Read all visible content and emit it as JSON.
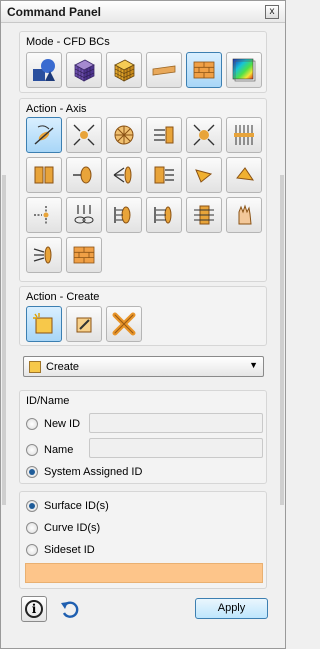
{
  "window": {
    "title": "Command Panel",
    "close_label": "x"
  },
  "mode": {
    "title": "Mode - CFD BCs",
    "buttons": [
      {
        "icon": "solid-shapes-icon",
        "active": false
      },
      {
        "icon": "purple-mesh-cube-icon",
        "active": false
      },
      {
        "icon": "yellow-mesh-cube-icon",
        "active": false
      },
      {
        "icon": "surface-plank-icon",
        "active": false
      },
      {
        "icon": "brick-wall-icon",
        "active": true
      },
      {
        "icon": "contour-plot-icon",
        "active": false
      }
    ]
  },
  "action_axis": {
    "title": "Action - Axis",
    "buttons": [
      {
        "icon": "axis-rotate-icon",
        "active": true
      },
      {
        "icon": "fan-icon"
      },
      {
        "icon": "propeller-icon"
      },
      {
        "icon": "inlet-arrows-icon"
      },
      {
        "icon": "fan-sink-icon"
      },
      {
        "icon": "vent-lines-icon"
      },
      {
        "icon": "split-block-icon"
      },
      {
        "icon": "orifice-icon"
      },
      {
        "icon": "flow-spread-icon"
      },
      {
        "icon": "grille-arrows-icon"
      },
      {
        "icon": "triangle-flap-icon"
      },
      {
        "icon": "triangle-flap-alt-icon"
      },
      {
        "icon": "point-flow-icon"
      },
      {
        "icon": "multi-flow-icon"
      },
      {
        "icon": "bracket-flow-icon"
      },
      {
        "icon": "ellipse-flow-icon"
      },
      {
        "icon": "stack-flow-icon"
      },
      {
        "icon": "hand-icon"
      },
      {
        "icon": "disk-arrows-icon"
      },
      {
        "icon": "brick-icon"
      }
    ]
  },
  "action_create": {
    "title": "Action - Create",
    "buttons": [
      {
        "icon": "new-block-icon",
        "active": true
      },
      {
        "icon": "edit-pencil-icon"
      },
      {
        "icon": "delete-x-icon"
      }
    ]
  },
  "operation_combo": {
    "value": "Create",
    "icon": "new-block-icon"
  },
  "idname": {
    "title": "ID/Name",
    "options": [
      {
        "label": "New ID",
        "checked": false,
        "has_field": true,
        "field_value": ""
      },
      {
        "label": "Name",
        "checked": false,
        "has_field": true,
        "field_value": ""
      },
      {
        "label": "System Assigned ID",
        "checked": true,
        "has_field": false
      }
    ]
  },
  "entity": {
    "options": [
      {
        "label": "Surface ID(s)",
        "checked": true
      },
      {
        "label": "Curve ID(s)",
        "checked": false
      },
      {
        "label": "Sideset ID",
        "checked": false
      }
    ],
    "input_value": "",
    "input_color": "#fdc58a"
  },
  "footer": {
    "info_icon": "info-icon",
    "undo_icon": "undo-icon",
    "apply_label": "Apply"
  }
}
